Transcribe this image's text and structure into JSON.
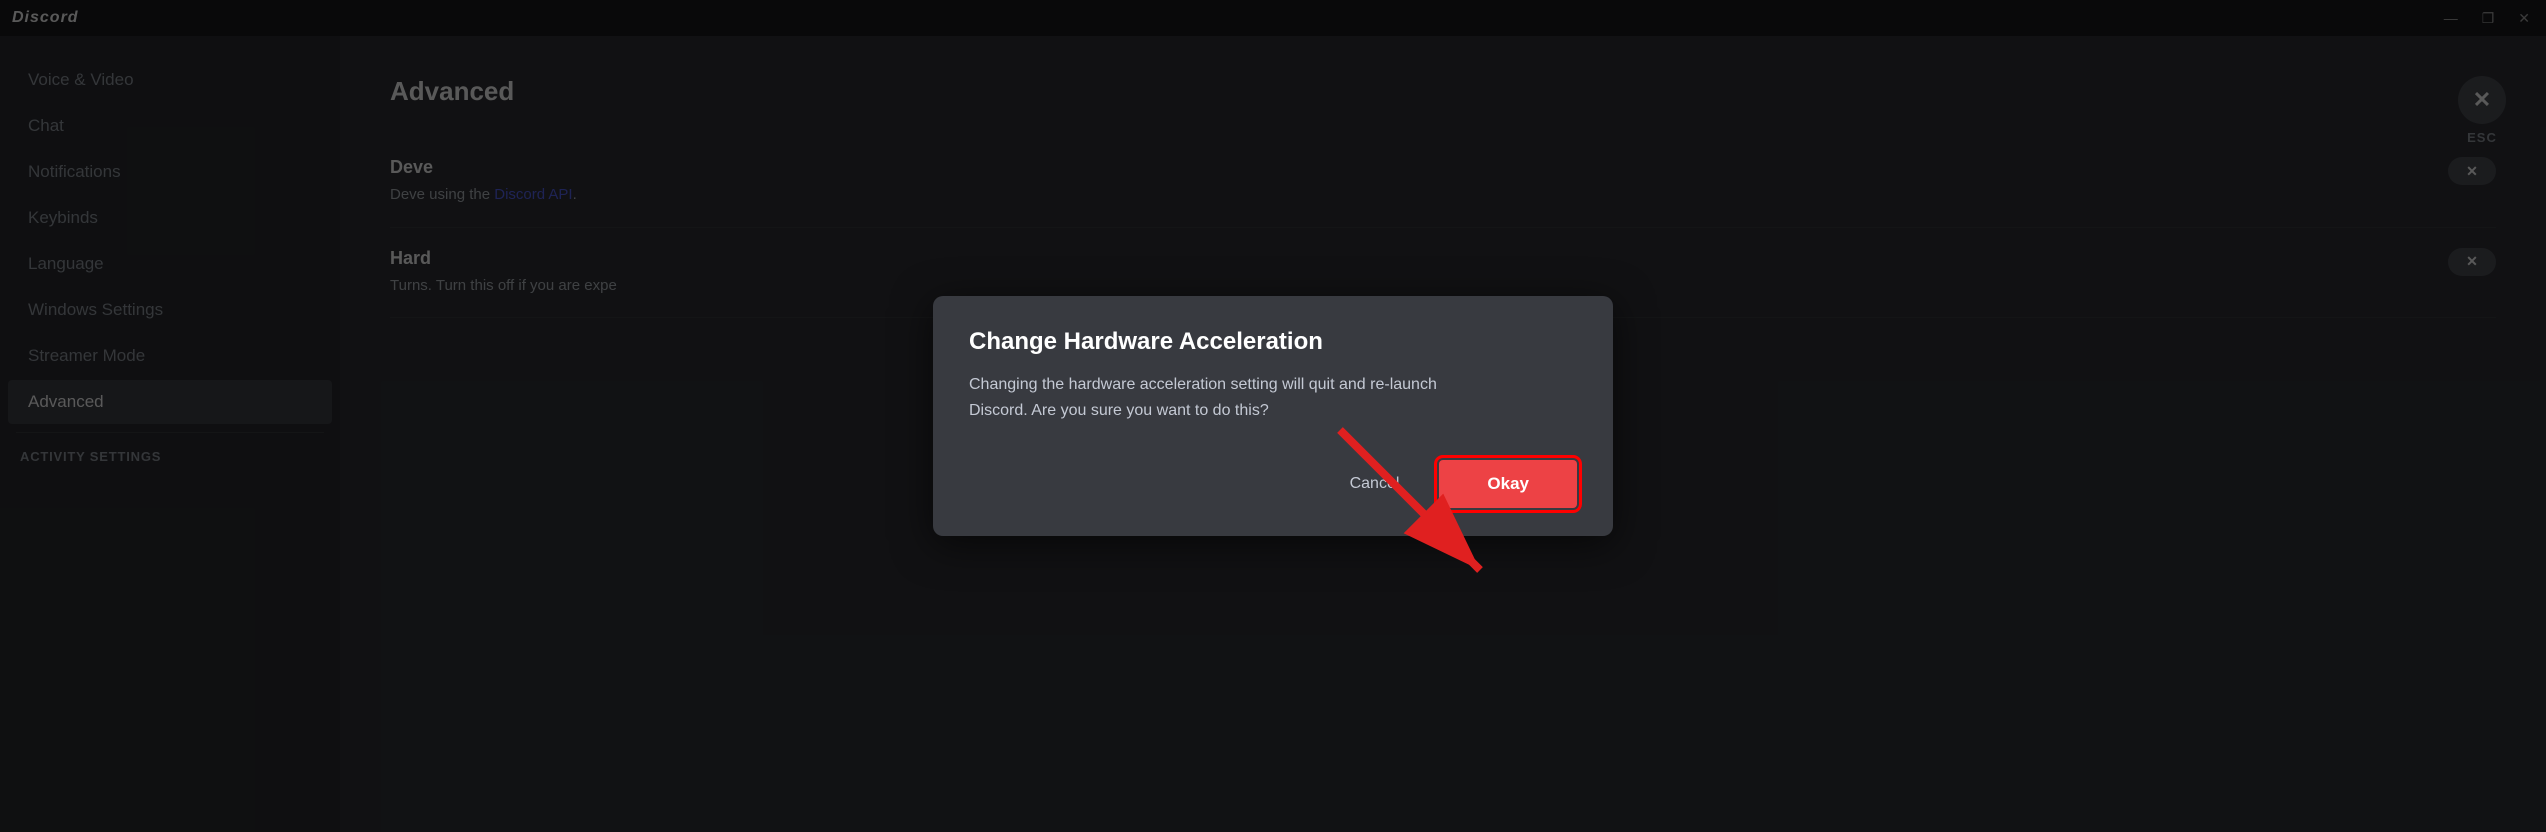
{
  "titlebar": {
    "logo": "Discord",
    "minimize": "—",
    "maximize": "❐",
    "close": "✕"
  },
  "sidebar": {
    "items": [
      {
        "id": "voice-video",
        "label": "Voice & Video",
        "active": false
      },
      {
        "id": "chat",
        "label": "Chat",
        "active": false
      },
      {
        "id": "notifications",
        "label": "Notifications",
        "active": false
      },
      {
        "id": "keybinds",
        "label": "Keybinds",
        "active": false
      },
      {
        "id": "language",
        "label": "Language",
        "active": false
      },
      {
        "id": "windows-settings",
        "label": "Windows Settings",
        "active": false
      },
      {
        "id": "streamer-mode",
        "label": "Streamer Mode",
        "active": false
      },
      {
        "id": "advanced",
        "label": "Advanced",
        "active": true
      }
    ],
    "section_activity": "ACTIVITY SETTINGS"
  },
  "main": {
    "section_title": "Advanced",
    "settings": [
      {
        "id": "developer-mode",
        "name": "Deve",
        "desc": "Deve",
        "desc_link": "Discord API",
        "desc_suffix": "using the"
      },
      {
        "id": "hardware-accel",
        "name": "Hard",
        "desc": "Turns. Turn this off if you are expe"
      }
    ]
  },
  "close_btn": {
    "label": "ESC"
  },
  "dialog": {
    "title": "Change Hardware Acceleration",
    "body": "Changing the hardware acceleration setting will quit and re-launch\nDiscord. Are you sure you want to do this?",
    "cancel_label": "Cancel",
    "okay_label": "Okay"
  }
}
